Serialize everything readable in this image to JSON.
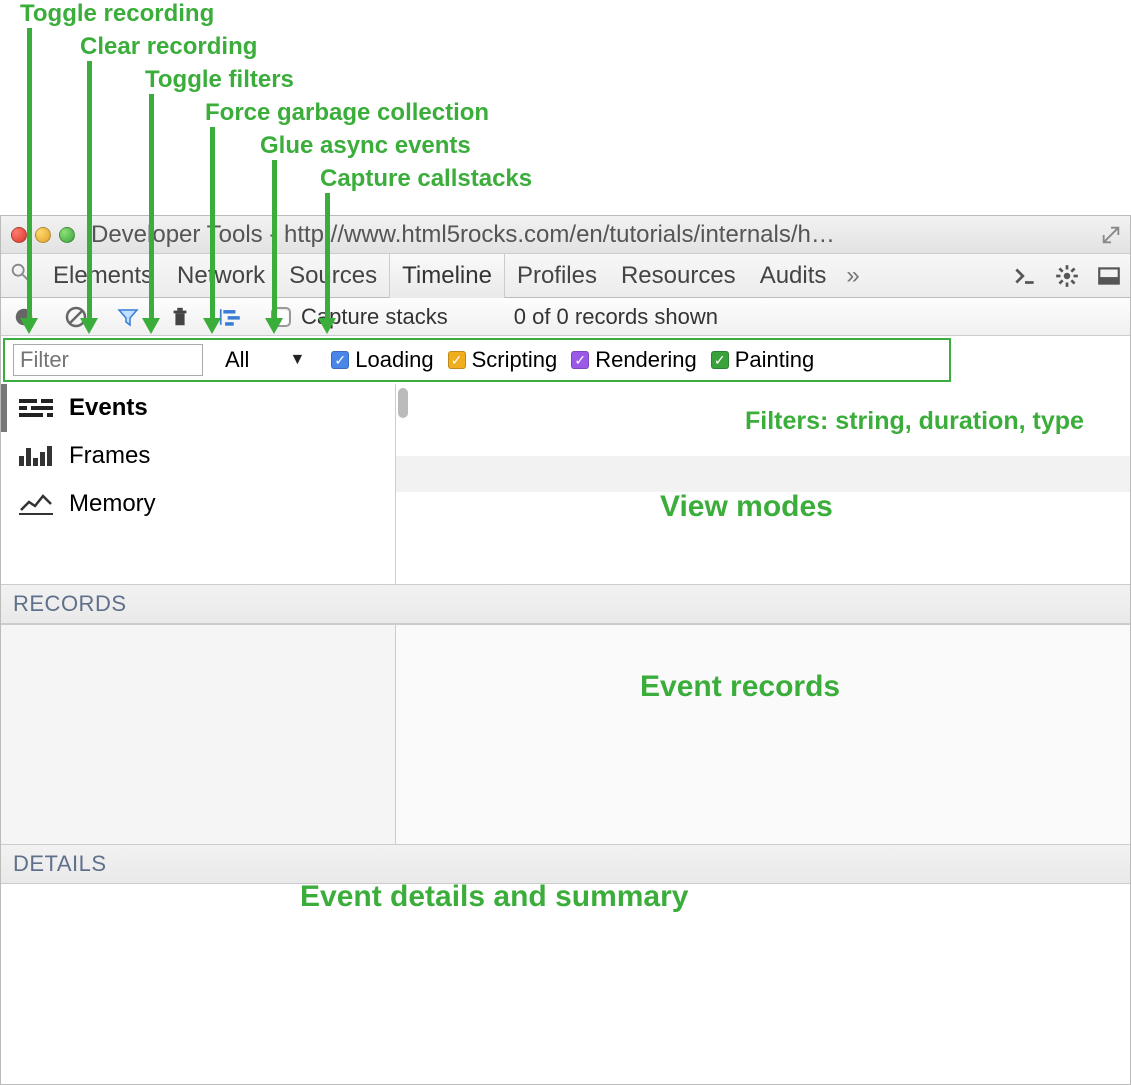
{
  "annotations": {
    "toggle_recording": "Toggle recording",
    "clear_recording": "Clear recording",
    "toggle_filters": "Toggle filters",
    "force_gc": "Force garbage collection",
    "glue_async": "Glue async events",
    "capture_callstacks": "Capture callstacks",
    "filters_label": "Filters: string, duration, type",
    "view_modes": "View modes",
    "event_records": "Event records",
    "event_details": "Event details and summary"
  },
  "window": {
    "title": "Developer Tools - http://www.html5rocks.com/en/tutorials/internals/h…"
  },
  "tabs": {
    "items": [
      "Elements",
      "Network",
      "Sources",
      "Timeline",
      "Profiles",
      "Resources",
      "Audits"
    ],
    "overflow": "»",
    "active_index": 3
  },
  "toolbar": {
    "capture_label": "Capture stacks",
    "status": "0 of 0 records shown"
  },
  "filterbar": {
    "placeholder": "Filter",
    "select_label": "All",
    "cats": [
      {
        "label": "Loading",
        "color": "blue"
      },
      {
        "label": "Scripting",
        "color": "amber"
      },
      {
        "label": "Rendering",
        "color": "purple"
      },
      {
        "label": "Painting",
        "color": "green"
      }
    ]
  },
  "modes": {
    "items": [
      "Events",
      "Frames",
      "Memory"
    ],
    "active_index": 0
  },
  "sections": {
    "records": "RECORDS",
    "details": "DETAILS"
  }
}
